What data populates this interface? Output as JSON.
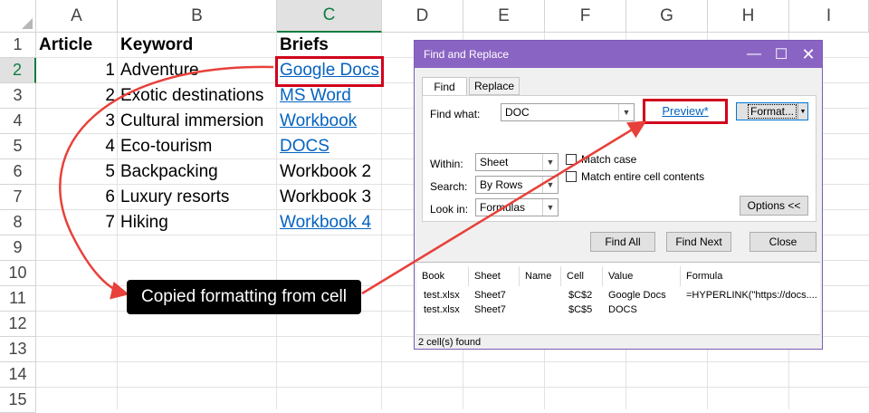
{
  "columns": [
    "A",
    "B",
    "C",
    "D",
    "E",
    "F",
    "G",
    "H",
    "I"
  ],
  "rows": [
    "1",
    "2",
    "3",
    "4",
    "5",
    "6",
    "7",
    "8",
    "9",
    "10",
    "11",
    "12",
    "13",
    "14",
    "15"
  ],
  "sheet": {
    "header": {
      "article": "Article",
      "keyword": "Keyword",
      "briefs": "Briefs"
    },
    "data": [
      {
        "num": "1",
        "keyword": "Adventure",
        "brief": "Google Docs",
        "link": true
      },
      {
        "num": "2",
        "keyword": "Exotic destinations",
        "brief": "MS Word",
        "link": true
      },
      {
        "num": "3",
        "keyword": "Cultural immersion",
        "brief": "Workbook",
        "link": true
      },
      {
        "num": "4",
        "keyword": "Eco-tourism",
        "brief": "DOCS",
        "link": true
      },
      {
        "num": "5",
        "keyword": "Backpacking",
        "brief": "Workbook 2",
        "link": false
      },
      {
        "num": "6",
        "keyword": "Luxury resorts",
        "brief": "Workbook 3",
        "link": false
      },
      {
        "num": "7",
        "keyword": "Hiking",
        "brief": "Workbook 4",
        "link": true
      }
    ]
  },
  "dialog": {
    "title": "Find and Replace",
    "tabs": {
      "find": "Find",
      "replace": "Replace"
    },
    "find_what_label": "Find what:",
    "find_what_value": "DOC",
    "preview": "Preview*",
    "format_button": "Format...",
    "within_label": "Within:",
    "within_value": "Sheet",
    "search_label": "Search:",
    "search_value": "By Rows",
    "lookin_label": "Look in:",
    "lookin_value": "Formulas",
    "match_case": "Match case",
    "match_entire": "Match entire cell contents",
    "options_button": "Options <<",
    "find_all": "Find All",
    "find_next": "Find Next",
    "close": "Close",
    "results_headers": {
      "book": "Book",
      "sheet": "Sheet",
      "name": "Name",
      "cell": "Cell",
      "value": "Value",
      "formula": "Formula"
    },
    "results": [
      {
        "book": "test.xlsx",
        "sheet": "Sheet7",
        "name": "",
        "cell": "$C$2",
        "value": "Google Docs",
        "formula": "=HYPERLINK(\"https://docs...."
      },
      {
        "book": "test.xlsx",
        "sheet": "Sheet7",
        "name": "",
        "cell": "$C$5",
        "value": "DOCS",
        "formula": ""
      }
    ],
    "status": "2 cell(s) found"
  },
  "callout": "Copied formatting from cell",
  "colors": {
    "link": "#0563c1",
    "annotation": "#d0021b",
    "titlebar": "#8a64c3",
    "excel_green": "#107c41"
  }
}
